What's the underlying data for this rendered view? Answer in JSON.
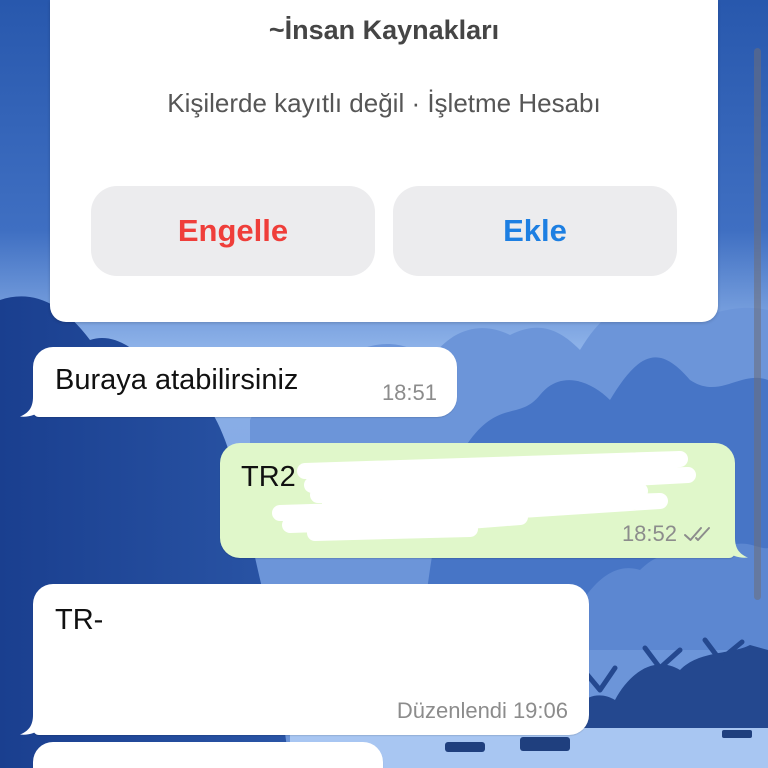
{
  "chat": {
    "contact_card": {
      "title": "~İnsan Kaynakları",
      "subtitle": "Kişilerde kayıtlı değil · İşletme Hesabı",
      "block_button": "Engelle",
      "add_button": "Ekle"
    },
    "messages": [
      {
        "direction": "incoming",
        "text": "Buraya atabilirsiniz",
        "time": "18:51"
      },
      {
        "direction": "outgoing",
        "text": "TR2",
        "time": "18:52",
        "status_icon": "double-check-icon"
      },
      {
        "direction": "incoming",
        "text": "TR-",
        "edited_label": "Düzenlendi",
        "time": "19:06"
      },
      {
        "direction": "incoming"
      }
    ]
  },
  "colors": {
    "red": "#ef3e3a",
    "blue": "#1d7fe2",
    "green": "#e0f7ca",
    "bubble-in": "#ffffff",
    "meta": "#8c8c8c"
  },
  "icons": {
    "message_status": "double-check-icon",
    "bubble_tail": "bubble-tail-icon"
  }
}
